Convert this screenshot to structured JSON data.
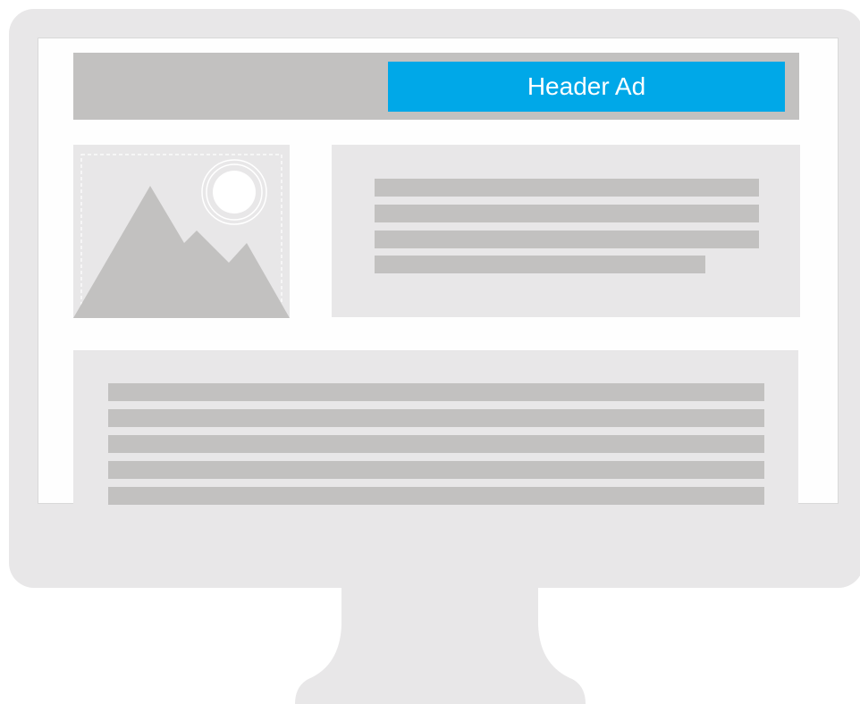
{
  "header": {
    "ad_label": "Header Ad",
    "ad_color": "#00a8e8"
  },
  "colors": {
    "monitor": "#e8e7e8",
    "screen": "#fefefe",
    "placeholder_bar": "#c2c1c0",
    "panel": "#e8e7e8"
  },
  "icons": {
    "image_placeholder": "mountain-sun-icon"
  }
}
